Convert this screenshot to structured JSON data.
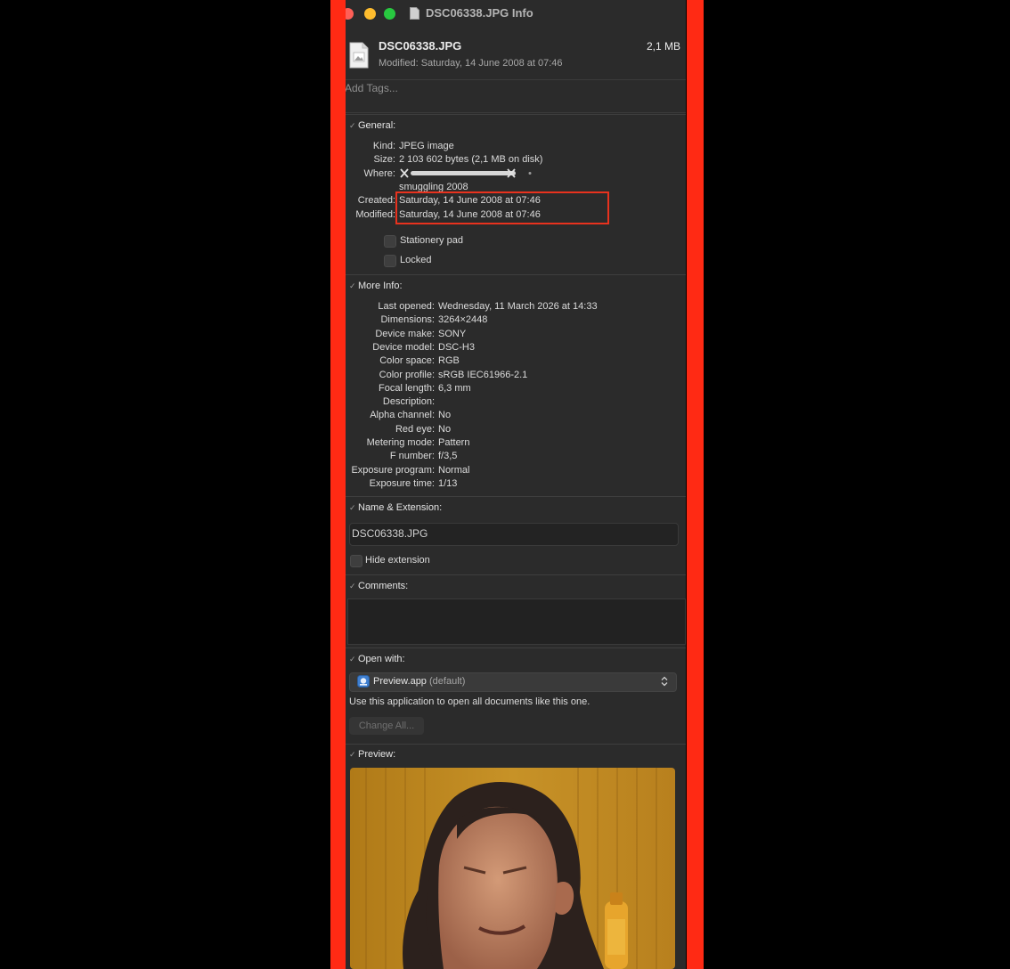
{
  "window": {
    "title": "DSC06338.JPG Info",
    "filename": "DSC06338.JPG",
    "size": "2,1 MB",
    "modified_line": "Modified: Saturday, 14 June 2008 at 07:46",
    "tags_placeholder": "Add Tags..."
  },
  "general": {
    "header": "General:",
    "kind_label": "Kind:",
    "kind": "JPEG image",
    "size_label": "Size:",
    "size": "2 103 602 bytes (2,1 MB on disk)",
    "where_label": "Where:",
    "where_line2": "smuggling 2008",
    "created_label": "Created:",
    "created": "Saturday, 14 June 2008 at 07:46",
    "modified_label": "Modified:",
    "modified": "Saturday, 14 June 2008 at 07:46",
    "stationery": "Stationery pad",
    "locked": "Locked"
  },
  "more_info": {
    "header": "More Info:",
    "rows": [
      {
        "k": "Last opened:",
        "v": "Wednesday, 11 March 2026 at 14:33"
      },
      {
        "k": "Dimensions:",
        "v": "3264×2448"
      },
      {
        "k": "Device make:",
        "v": "SONY"
      },
      {
        "k": "Device model:",
        "v": "DSC-H3"
      },
      {
        "k": "Color space:",
        "v": "RGB"
      },
      {
        "k": "Color profile:",
        "v": "sRGB IEC61966-2.1"
      },
      {
        "k": "Focal length:",
        "v": "6,3 mm"
      },
      {
        "k": "Description:",
        "v": ""
      },
      {
        "k": "Alpha channel:",
        "v": "No"
      },
      {
        "k": "Red eye:",
        "v": "No"
      },
      {
        "k": "Metering mode:",
        "v": "Pattern"
      },
      {
        "k": "F number:",
        "v": "f/3,5"
      },
      {
        "k": "Exposure program:",
        "v": "Normal"
      },
      {
        "k": "Exposure time:",
        "v": "1/13"
      }
    ]
  },
  "name_ext": {
    "header": "Name & Extension:",
    "value": "DSC06338.JPG",
    "hide_extension": "Hide extension"
  },
  "comments": {
    "header": "Comments:"
  },
  "open_with": {
    "header": "Open with:",
    "app": "Preview.app",
    "default_tag": "(default)",
    "note": "Use this application to open all documents like this one.",
    "change_all": "Change All..."
  },
  "preview": {
    "header": "Preview:"
  },
  "colors": {
    "annotation": "#ff2a14",
    "highlight_box": "#e8321e",
    "window_bg": "#2b2b2b"
  },
  "icons": [
    "close-button",
    "minimize-button",
    "zoom-button",
    "document-icon",
    "preview-app-icon",
    "chevron-updown-icon"
  ]
}
